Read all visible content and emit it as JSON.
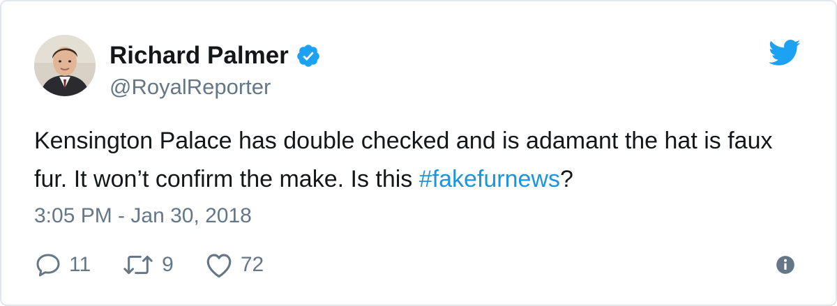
{
  "user": {
    "display_name": "Richard Palmer",
    "handle": "@RoyalReporter",
    "verified": true,
    "avatar_icon": "user-avatar"
  },
  "tweet": {
    "text_before": "Kensington Palace has double checked and is adamant the hat is faux fur. It won’t confirm the make. Is this ",
    "hashtag": "#fakefurnews",
    "text_after": "?",
    "timestamp": "3:05 PM - Jan 30, 2018"
  },
  "actions": {
    "replies": "11",
    "retweets": "9",
    "likes": "72"
  },
  "icons": {
    "brand": "twitter-bird-icon",
    "verified": "verified-badge-icon",
    "reply": "reply-icon",
    "retweet": "retweet-icon",
    "like": "heart-icon",
    "info": "info-icon"
  },
  "colors": {
    "brand_blue": "#1da1f2",
    "hashtag": "#1b95e0",
    "muted_text": "#657786",
    "primary_text": "#14171a",
    "border": "#e1e8ed"
  }
}
